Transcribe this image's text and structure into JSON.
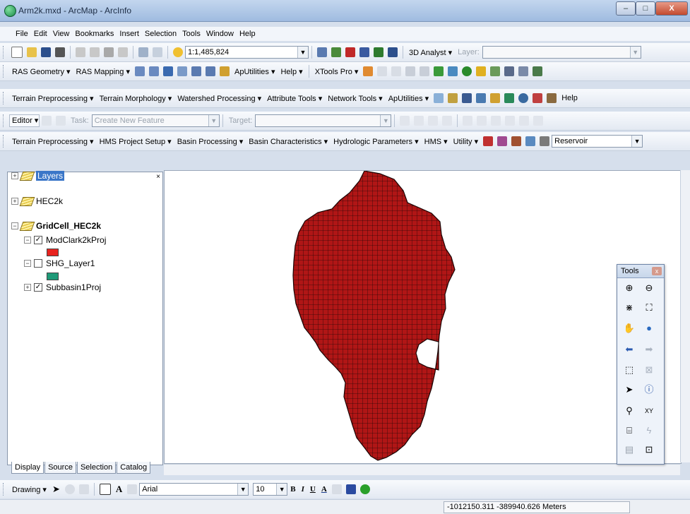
{
  "window": {
    "title": "Arm2k.mxd - ArcMap - ArcInfo",
    "minimize": "–",
    "maximize": "□",
    "close": "X"
  },
  "menu": [
    "File",
    "Edit",
    "View",
    "Bookmarks",
    "Insert",
    "Selection",
    "Tools",
    "Window",
    "Help"
  ],
  "standard_toolbar": {
    "scale": "1:1,485,824",
    "analyst": "3D Analyst ▾",
    "layer_label": "Layer:"
  },
  "ras_toolbar": {
    "ras_geometry": "RAS Geometry ▾",
    "ras_mapping": "RAS Mapping ▾",
    "aputilities": "ApUtilities ▾",
    "help": "Help ▾",
    "xtools": "XTools Pro ▾"
  },
  "archydro_toolbar": {
    "items": [
      "Terrain Preprocessing ▾",
      "Terrain Morphology ▾",
      "Watershed Processing ▾",
      "Attribute Tools ▾",
      "Network Tools ▾",
      "ApUtilities ▾"
    ],
    "help": "Help"
  },
  "editor_toolbar": {
    "editor": "Editor ▾",
    "task_label": "Task:",
    "task_value": "Create New Feature",
    "target_label": "Target:"
  },
  "hms_toolbar": {
    "items": [
      "Terrain Preprocessing ▾",
      "HMS Project Setup ▾",
      "Basin Processing ▾",
      "Basin Characteristics ▾",
      "Hydrologic Parameters ▾",
      "HMS ▾",
      "Utility ▾"
    ],
    "reservoir": "Reservoir"
  },
  "toc": {
    "layers": "Layers",
    "frame_hec": "HEC2k",
    "frame_grid": "GridCell_HEC2k",
    "layer1": {
      "name": "ModClark2kProj",
      "checked": "✓",
      "color": "#e8231f"
    },
    "layer2": {
      "name": "SHG_Layer1",
      "checked": "",
      "color": "#1f9a78"
    },
    "layer3": {
      "name": "Subbasin1Proj",
      "checked": "✓"
    },
    "close": "×"
  },
  "toc_tabs": [
    "Display",
    "Source",
    "Selection",
    "Catalog"
  ],
  "tools_window": {
    "title": "Tools",
    "close": "x"
  },
  "drawing_toolbar": {
    "drawing": "Drawing ▾",
    "font": "Arial",
    "size": "10",
    "bold": "B",
    "italic": "I",
    "underline": "U",
    "font_color": "A"
  },
  "status": {
    "coordinates": "-1012150.311  -389940.626 Meters"
  },
  "map": {
    "fill_color": "#b01616",
    "grid_color": "#2a0606"
  }
}
